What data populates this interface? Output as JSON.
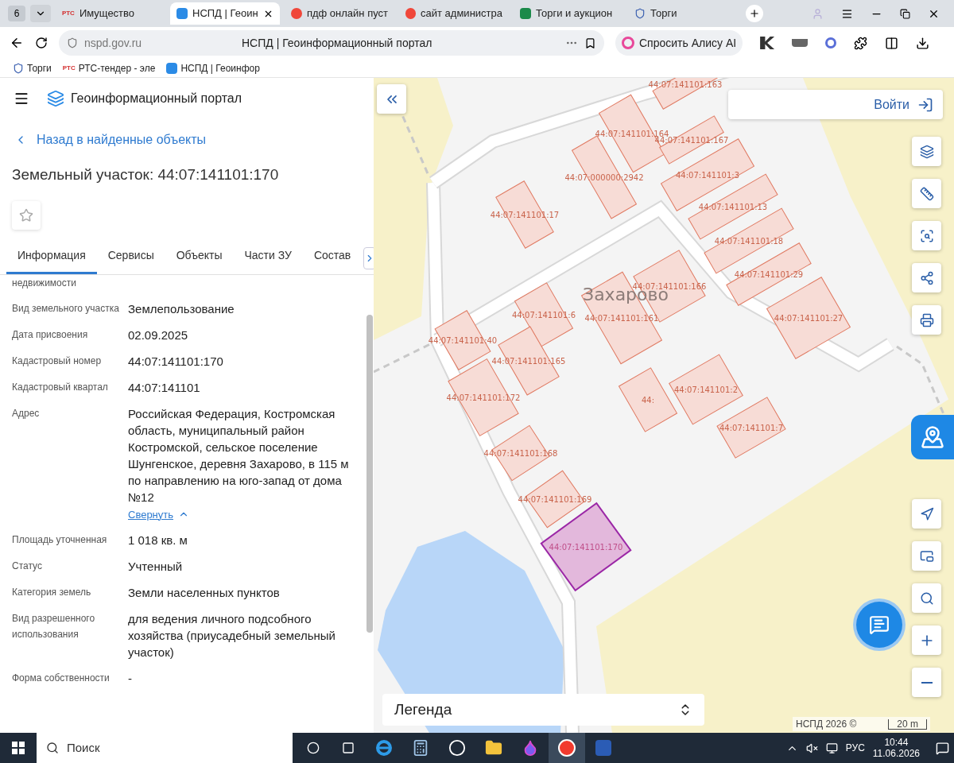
{
  "browser": {
    "tab_count": "6",
    "tabs": [
      {
        "kind": "rts",
        "favicon_text": "РТС",
        "title": "Имущество",
        "selected": false
      },
      {
        "kind": "nspd",
        "title": "НСПД | Геоин",
        "selected": true
      },
      {
        "kind": "yandex",
        "title": "пдф онлайн пуст",
        "selected": false
      },
      {
        "kind": "yandex",
        "title": "сайт администра",
        "selected": false
      },
      {
        "kind": "torgi",
        "title": "Торги и аукцион",
        "selected": false
      },
      {
        "kind": "emblem",
        "title": "Торги",
        "selected": false
      }
    ],
    "address": {
      "domain": "nspd.gov.ru",
      "page_title": "НСПД | Геоинформационный портал"
    },
    "alice_button": "Спросить Алису AI",
    "bookmarks": [
      {
        "kind": "emblem",
        "label": "Торги"
      },
      {
        "kind": "rts",
        "favicon_text": "РТС",
        "label": "РТС-тендер - эле"
      },
      {
        "kind": "nspd",
        "label": "НСПД | Геоинфор"
      }
    ]
  },
  "portal": {
    "title": "Геоинформационный портал",
    "back_link": "Назад в найденные объекты",
    "heading": "Земельный участок: 44:07:141101:170",
    "favorite": false,
    "tabs": [
      {
        "label": "Информация",
        "selected": true
      },
      {
        "label": "Сервисы",
        "selected": false
      },
      {
        "label": "Объекты",
        "selected": false
      },
      {
        "label": "Части ЗУ",
        "selected": false
      },
      {
        "label": "Состав",
        "selected": false
      }
    ],
    "fields": [
      {
        "label": "недвижимости"
      },
      {
        "label": "Вид земельного участка",
        "value": "Землепользование"
      },
      {
        "label": "Дата присвоения",
        "value": "02.09.2025"
      },
      {
        "label": "Кадастровый номер",
        "value": "44:07:141101:170"
      },
      {
        "label": "Кадастровый квартал",
        "value": "44:07:141101"
      },
      {
        "label": "Адрес",
        "value": "Российская Федерация, Костромская область, муниципальный район Костромской, сельское поселение Шунгенское, деревня Захарово, в 115 м по направлению на юго-запад от дома №12",
        "link": "Свернуть"
      },
      {
        "label": "Площадь уточненная",
        "value": "1 018 кв. м"
      },
      {
        "label": "Статус",
        "value": "Учтенный"
      },
      {
        "label": "Категория земель",
        "value": "Земли населенных пунктов"
      },
      {
        "label": "Вид разрешенного использования",
        "value": "для ведения личного подсобного хозяйства (приусадебный земельный участок)"
      },
      {
        "label": "Форма собственности",
        "value": "-"
      }
    ]
  },
  "map": {
    "login": "Войти",
    "place_label": "Захарово",
    "parcels": [
      {
        "label": "44:07:141101:163",
        "selected": false
      },
      {
        "label": "44:07:141101:164",
        "selected": false
      },
      {
        "label": "44:07:141101:167",
        "selected": false
      },
      {
        "label": "44:07:000000:2942",
        "selected": false
      },
      {
        "label": "44:07:141101:3",
        "selected": false
      },
      {
        "label": "44:07:141101:17",
        "selected": false
      },
      {
        "label": "44:07:141101:13",
        "selected": false
      },
      {
        "label": "44:07:141101:18",
        "selected": false
      },
      {
        "label": "44:07:141101:29",
        "selected": false
      },
      {
        "label": "44:07:141101:166",
        "selected": false
      },
      {
        "label": "44:07:141101:161",
        "selected": false
      },
      {
        "label": "44:07:141101:27",
        "selected": false
      },
      {
        "label": "44:07:141101:40",
        "selected": false
      },
      {
        "label": "44:07:141101:6",
        "selected": false
      },
      {
        "label": "44:07:141101:165",
        "selected": false
      },
      {
        "label": "44:07:141101:172",
        "selected": false
      },
      {
        "label": "44:",
        "selected": false
      },
      {
        "label": "44:07:141101:2",
        "selected": false
      },
      {
        "label": "44:07:141101:7",
        "selected": false
      },
      {
        "label": "44:07:141101:168",
        "selected": false
      },
      {
        "label": "44:07:141101:169",
        "selected": false
      },
      {
        "label": "44:07:141101:170",
        "selected": true
      }
    ],
    "legend": "Легенда",
    "attribution": "НСПД 2026 ©",
    "scale": "20 m"
  },
  "taskbar": {
    "search_placeholder": "Поиск",
    "apps": [
      {
        "kind": "ie",
        "selected": false
      },
      {
        "kind": "calculator",
        "selected": false
      },
      {
        "kind": "c",
        "selected": false
      },
      {
        "kind": "folder",
        "selected": false
      },
      {
        "kind": "drop",
        "selected": false
      },
      {
        "kind": "yandex",
        "selected": true
      },
      {
        "kind": "word",
        "selected": false
      }
    ],
    "language": "РУС",
    "time": "10:44",
    "date": "11.06.2026"
  }
}
